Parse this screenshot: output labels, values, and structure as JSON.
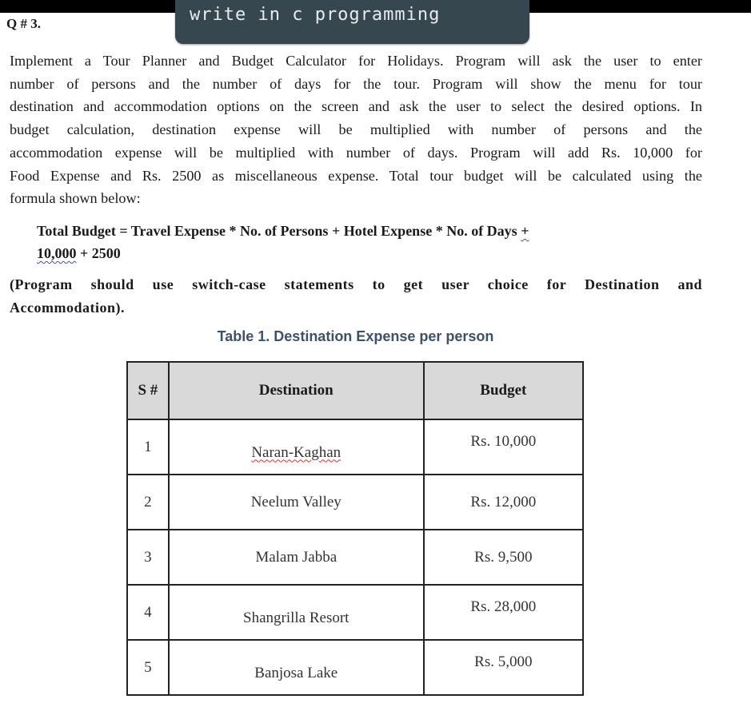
{
  "question_label": "Q # 3.",
  "sticky_note": "write in c programming",
  "paragraph": {
    "lines": [
      "Implement a Tour Planner and Budget Calculator for Holidays. Program will ask the user to enter",
      "number of persons and the number of days for the tour. Program will show the menu for tour",
      "destination and accommodation options on the screen and ask the user to select the desired options. In",
      "budget calculation, destination expense will be multiplied with number of persons and the",
      "accommodation expense will be multiplied with number of days. Program will add Rs. 10,000 for",
      "Food Expense and Rs. 2500 as miscellaneous expense. Total tour budget will be calculated using the",
      "formula shown below:"
    ]
  },
  "formula": {
    "line1": "Total Budget = Travel Expense * No. of Persons + Hotel Expense * No.  of Days ",
    "line1_plus": "+",
    "line2_num": "10,000",
    "line2_rest": " + 2500"
  },
  "switch_note": {
    "line1": "(Program should use switch-case statements to get user choice for Destination and",
    "line2": "Accommodation)."
  },
  "table": {
    "caption": "Table 1. Destination Expense per person",
    "headers": [
      "S #",
      "Destination",
      "Budget"
    ],
    "rows": [
      {
        "sn": "1",
        "destination": "Naran-Kaghan",
        "budget": "Rs. 10,000"
      },
      {
        "sn": "2",
        "destination": "Neelum Valley",
        "budget": "Rs. 12,000"
      },
      {
        "sn": "3",
        "destination": "Malam Jabba",
        "budget": "Rs. 9,500"
      },
      {
        "sn": "4",
        "destination": "Shangrilla Resort",
        "budget": "Rs. 28,000"
      },
      {
        "sn": "5",
        "destination": "Banjosa Lake",
        "budget": "Rs. 5,000"
      }
    ]
  }
}
